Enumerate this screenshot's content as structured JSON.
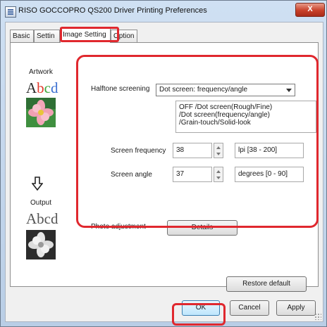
{
  "window": {
    "title": "RISO GOCCOPRO QS200 Driver Printing Preferences",
    "close_label": "X"
  },
  "tabs": [
    {
      "label": "Basic"
    },
    {
      "label": "Settin"
    },
    {
      "label": "Image Setting"
    },
    {
      "label": "Option"
    }
  ],
  "preview": {
    "artwork_label": "Artwork",
    "artwork_sample_text": [
      "A",
      "b",
      "c",
      "d"
    ],
    "output_label": "Output",
    "output_sample_text": "Abcd"
  },
  "halftone": {
    "label": "Halftone screening",
    "selected": "Dot screen: frequency/angle",
    "info_lines": [
      "OFF /Dot screen(Rough/Fine)",
      "/Dot screen(frequency/angle)",
      "/Grain-touch/Solid-look"
    ]
  },
  "screen_frequency": {
    "label": "Screen frequency",
    "value": "38",
    "unit": "lpi [38 - 200]"
  },
  "screen_angle": {
    "label": "Screen angle",
    "value": "37",
    "unit": "degrees [0 - 90]"
  },
  "photo_adjustment": {
    "label": "Photo adjustment",
    "details_label": "Details"
  },
  "buttons": {
    "restore_default": "Restore default",
    "ok": "OK",
    "cancel": "Cancel",
    "apply": "Apply"
  },
  "colors": {
    "highlight": "#e0282e",
    "artwork_letters": [
      "#2a2a2a",
      "#e23b2e",
      "#3da63a",
      "#3b6fd1"
    ]
  }
}
